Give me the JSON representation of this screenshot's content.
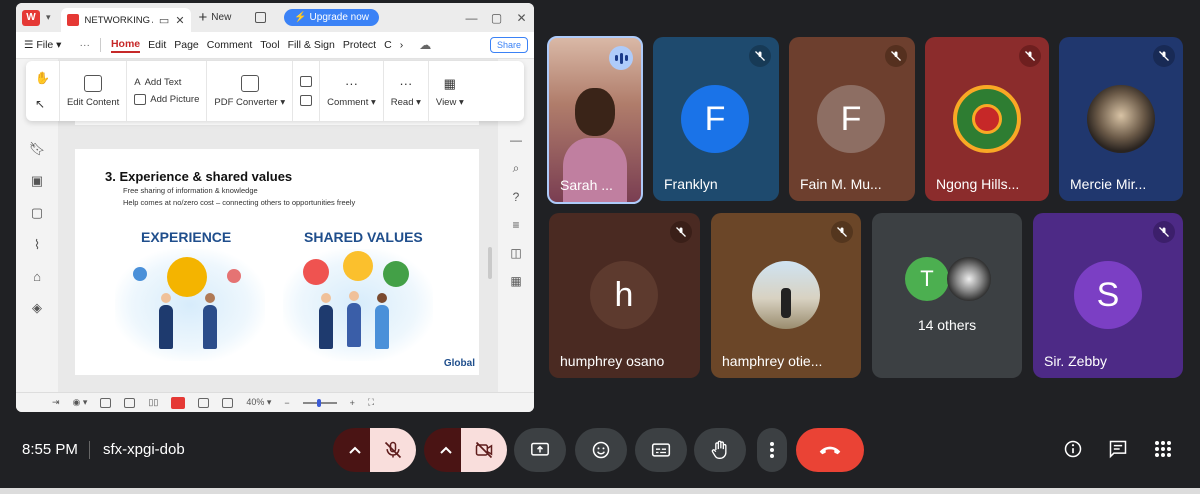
{
  "pdf_window": {
    "app_logo": "W",
    "tab_title": "NETWORKING AND",
    "new_tab_label": "New",
    "upgrade_label": "Upgrade now",
    "menu": {
      "file": "File",
      "items": [
        "Home",
        "Edit",
        "Page",
        "Comment",
        "Tool",
        "Fill & Sign",
        "Protect",
        "C"
      ],
      "active": "Home",
      "share_label": "Share"
    },
    "ribbon": {
      "edit_content": "Edit Content",
      "add_text": "Add Text",
      "add_picture": "Add Picture",
      "pdf_converter": "PDF Converter",
      "comment": "Comment",
      "read": "Read",
      "view": "View"
    },
    "page": {
      "heading": "3. Experience & shared values",
      "line1": "Free sharing of information & knowledge",
      "line2": "Help comes at no/zero cost – connecting others to opportunities freely",
      "label_experience": "EXPERIENCE",
      "label_shared": "SHARED VALUES",
      "logo": "Global"
    },
    "status": {
      "zoom": "40%"
    }
  },
  "participants": [
    {
      "name": "Sarah ...",
      "status": "speaking",
      "bg": "#5a3a2a"
    },
    {
      "name": "Franklyn",
      "initial": "F",
      "avatar_color": "#1a73e8",
      "bg": "#1e4a6e",
      "muted": true
    },
    {
      "name": "Fain M. Mu...",
      "initial": "F",
      "avatar_color": "#8d6e63",
      "bg": "#6d3f2e",
      "muted": true
    },
    {
      "name": "Ngong Hills...",
      "bg": "#8b2c2c",
      "muted": true,
      "avatar_icon": "rotary-club-logo"
    },
    {
      "name": "Mercie Mir...",
      "bg": "#20376e",
      "muted": true,
      "avatar_icon": "dog-photo"
    },
    {
      "name": "humphrey osano",
      "initial": "h",
      "avatar_color": "#5d3a2e",
      "bg": "#4a2a22",
      "muted": true
    },
    {
      "name": "hamphrey otie...",
      "bg": "#6b4628",
      "muted": true,
      "avatar_icon": "person-photo"
    },
    {
      "name": "14 others",
      "initial": "T",
      "avatar_color": "#4caf50",
      "bg": "#3c4043"
    },
    {
      "name": "Sir. Zebby",
      "initial": "S",
      "avatar_color": "#7b3fc4",
      "bg": "#4d2a86",
      "muted": true
    }
  ],
  "bottom_bar": {
    "time": "8:55 PM",
    "meeting_code": "sfx-xpgi-dob"
  }
}
